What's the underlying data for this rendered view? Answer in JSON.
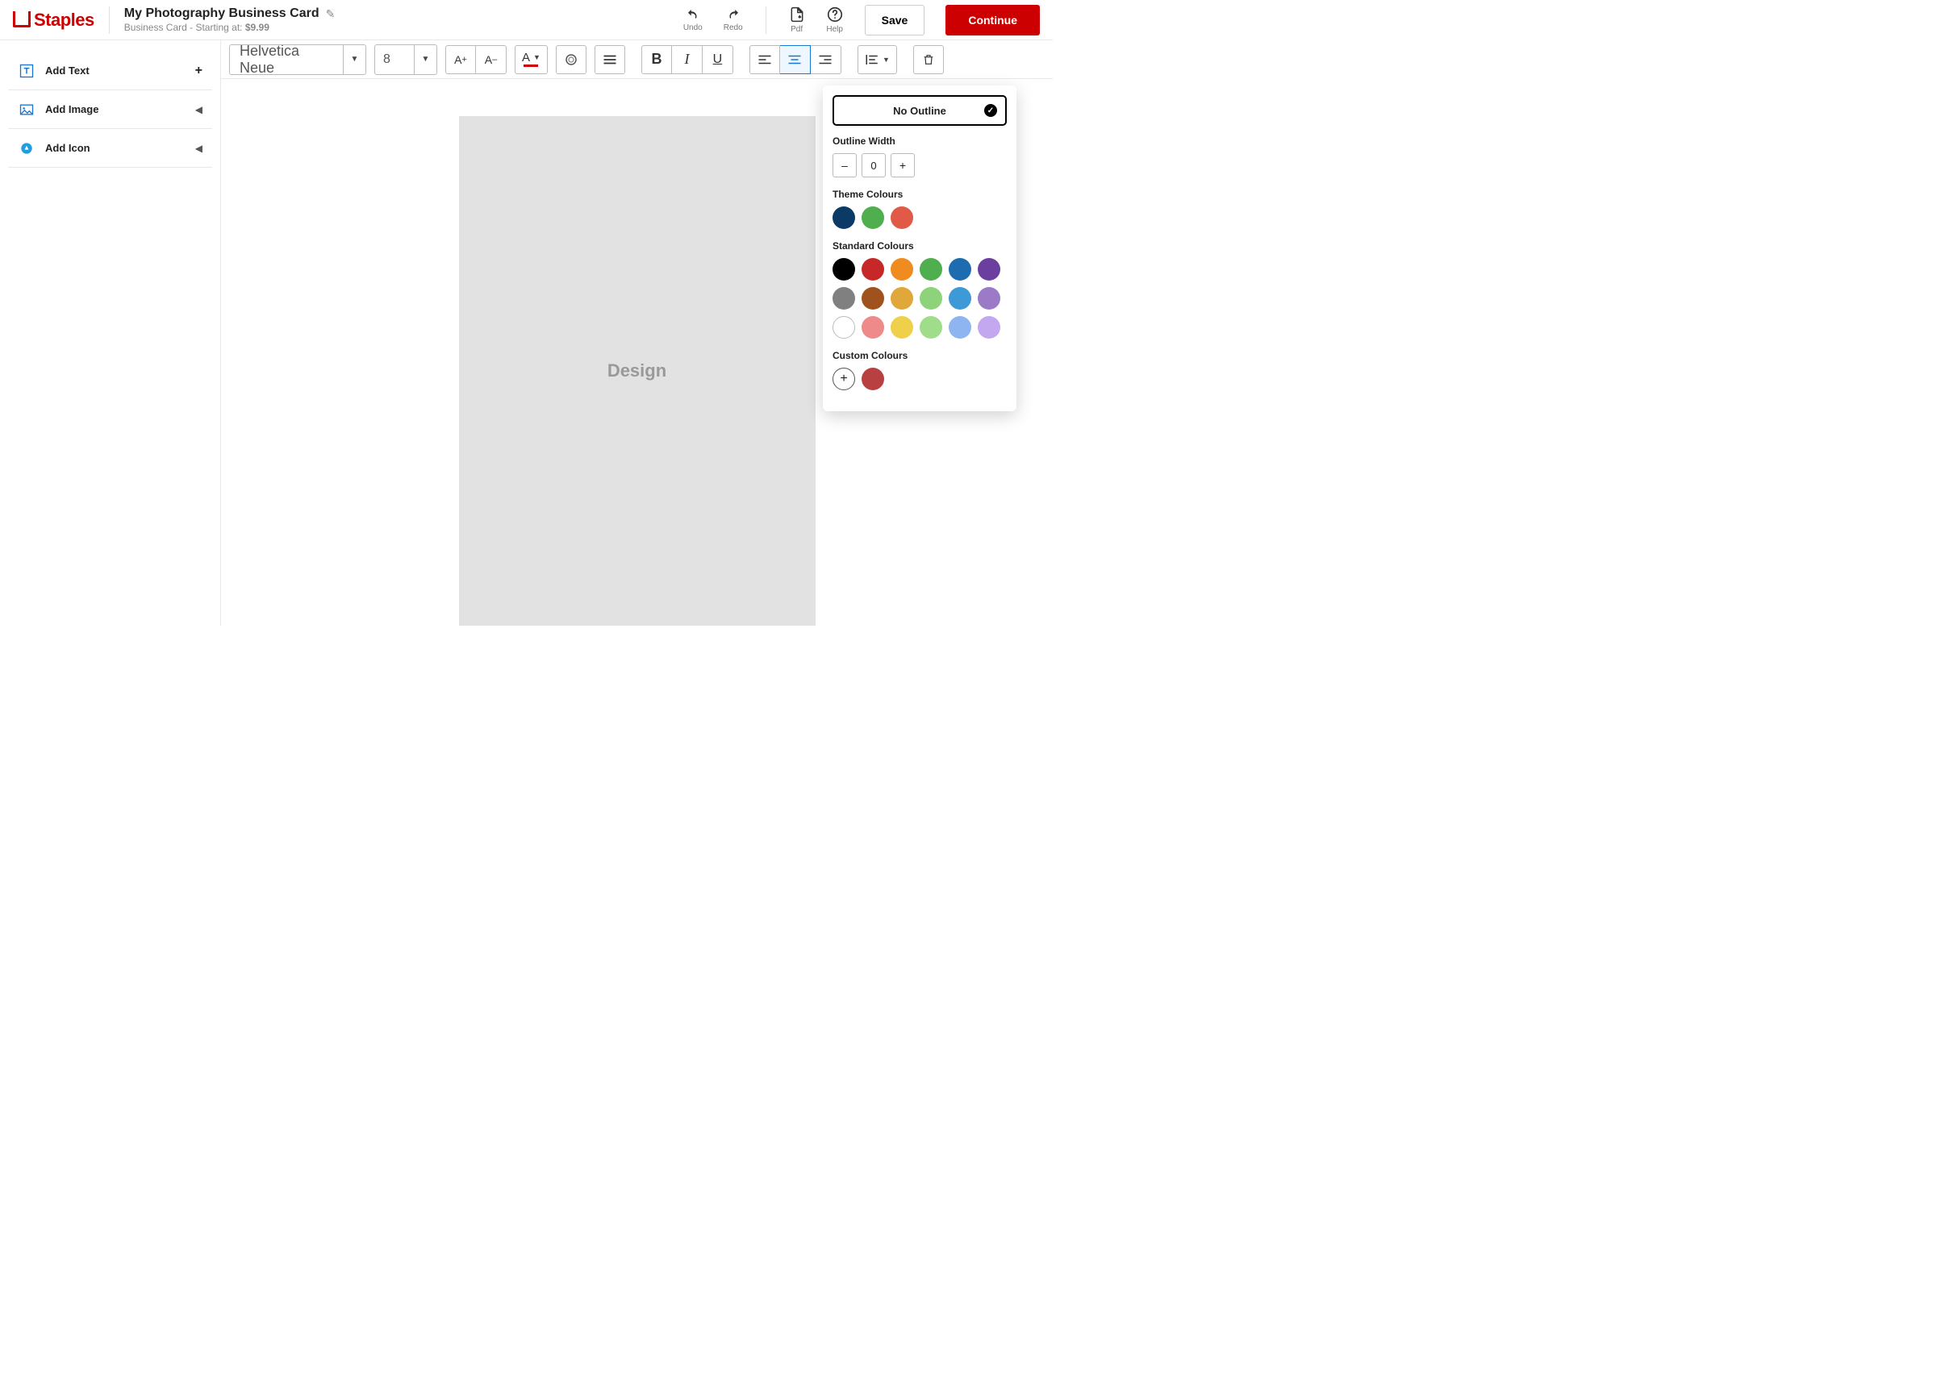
{
  "header": {
    "logo_text": "Staples",
    "doc_title": "My Photography Business Card",
    "subtitle_prefix": "Business Card - Starting at: ",
    "price": "$9.99",
    "undo": "Undo",
    "redo": "Redo",
    "pdf": "Pdf",
    "help": "Help",
    "save": "Save",
    "continue": "Continue"
  },
  "sidebar": {
    "add_text": "Add Text",
    "add_image": "Add Image",
    "add_icon": "Add Icon"
  },
  "toolbar": {
    "font_name": "Helvetica Neue",
    "font_size": "8",
    "increase_label": "A+",
    "decrease_label": "A–"
  },
  "canvas": {
    "placeholder": "Design"
  },
  "popover": {
    "no_outline": "No Outline",
    "outline_width_label": "Outline Width",
    "width_value": "0",
    "theme_label": "Theme Colours",
    "theme_colours": [
      "#0b3a66",
      "#4fae4d",
      "#e05a47"
    ],
    "standard_label": "Standard Colours",
    "standard_colours": [
      "#000000",
      "#c62828",
      "#ef8b1f",
      "#4fae4d",
      "#1e6cb0",
      "#6a3fa0",
      "#808080",
      "#a0521c",
      "#e0a83a",
      "#8ed37a",
      "#3e9ad6",
      "#9b7ac8",
      "#ffffff",
      "#ef8a8a",
      "#efd04a",
      "#a0dd8a",
      "#8fb5f0",
      "#c4a8ef"
    ],
    "custom_label": "Custom Colours",
    "custom_colours": [
      "#b84040"
    ]
  }
}
